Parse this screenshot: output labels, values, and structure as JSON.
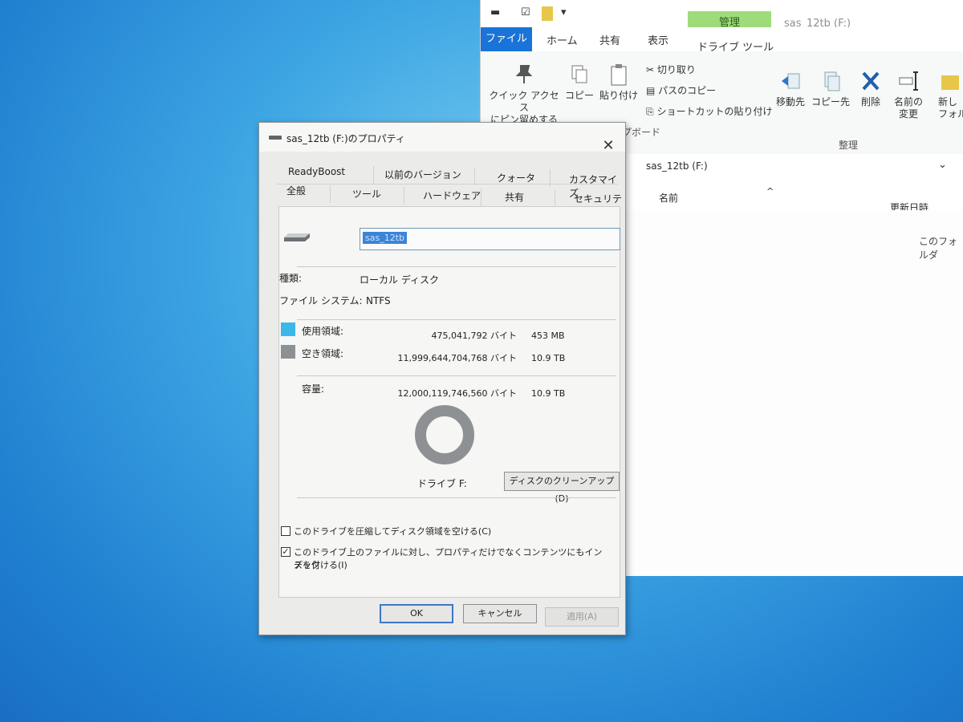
{
  "explorer": {
    "title": "sas_12tb (F:)",
    "manage_tab": "管理",
    "tabs": [
      "ファイル",
      "ホーム",
      "共有",
      "表示",
      "ドライブ ツール"
    ],
    "ribbon": {
      "pin": "クイック アクセス\nにピン留めする",
      "copy": "コピー",
      "paste": "貼り付け",
      "cut": "切り取り",
      "copy_path": "パスのコピー",
      "paste_shortcut": "ショートカットの貼り付け",
      "move_to": "移動先",
      "copy_to": "コピー先",
      "delete": "削除",
      "rename": "名前の\n変更",
      "new_folder": "新し\nフォル",
      "group_clipboard": "クリップボード",
      "group_organize": "整理"
    },
    "address": "sas_12tb (F:)",
    "columns": {
      "name": "名前",
      "modified": "更新日時"
    },
    "empty_text": "このフォルダ"
  },
  "dialog": {
    "title": "sas_12tb (F:)のプロパティ",
    "tabs_row1": [
      "ReadyBoost",
      "以前のバージョン",
      "クォータ",
      "カスタマイズ"
    ],
    "tabs_row2": [
      "全般",
      "ツール",
      "ハードウェア",
      "共有",
      "セキュリティ"
    ],
    "name_value": "sas_12tb",
    "type_label": "種類:",
    "type_value": "ローカル ディスク",
    "fs_label": "ファイル システム:",
    "fs_value": "NTFS",
    "used_label": "使用領域:",
    "used_bytes": "475,041,792 バイト",
    "used_size": "453 MB",
    "free_label": "空き領域:",
    "free_bytes": "11,999,644,704,768 バイト",
    "free_size": "10.9 TB",
    "capacity_label": "容量:",
    "capacity_bytes": "12,000,119,746,560 バイト",
    "capacity_size": "10.9 TB",
    "used_fraction": 3.96e-05,
    "drive_label": "ドライブ F:",
    "cleanup_button": "ディスクのクリーンアップ(D)",
    "compress_label": "このドライブを圧縮してディスク領域を空ける(C)",
    "compress_checked": false,
    "index_label_line1": "このドライブ上のファイルに対し、プロパティだけでなくコンテンツにもインデック",
    "index_label_line2": "スを付ける(I)",
    "index_checked": true,
    "ok": "OK",
    "cancel": "キャンセル",
    "apply": "適用(A)",
    "colors": {
      "used": "#3cb8e8",
      "free": "#8e9193",
      "accent": "#1a73d8"
    }
  }
}
